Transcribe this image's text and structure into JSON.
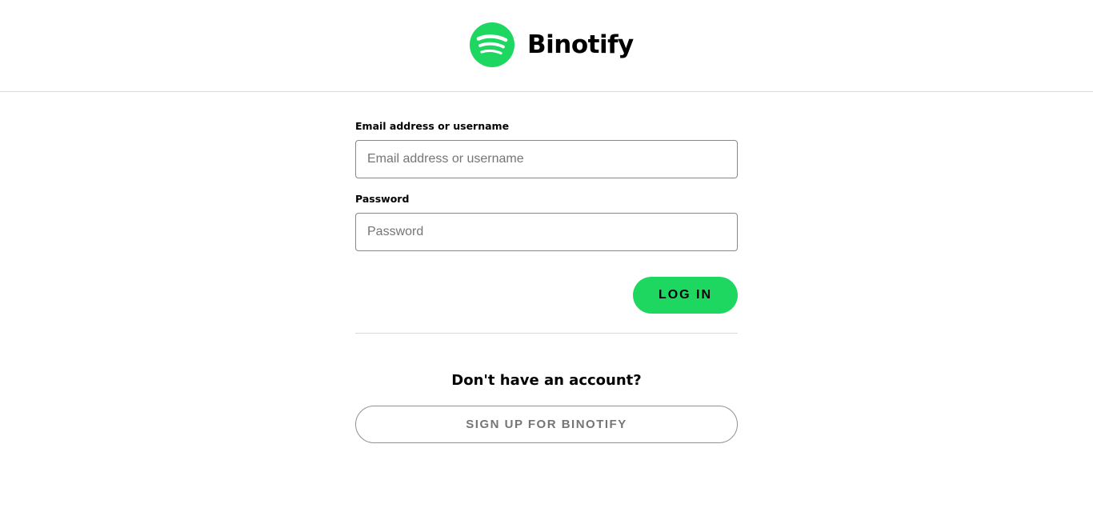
{
  "header": {
    "app_name": "Binotify",
    "logo_icon": "spotify-logo-icon"
  },
  "login_form": {
    "email": {
      "label": "Email address or username",
      "placeholder": "Email address or username",
      "value": ""
    },
    "password": {
      "label": "Password",
      "placeholder": "Password",
      "value": ""
    },
    "login_label": "LOG IN"
  },
  "signup": {
    "prompt": "Don't have an account?",
    "button_label": "SIGN UP FOR BINOTIFY"
  },
  "colors": {
    "brand_green": "#1ed760",
    "input_border": "#878787",
    "divider": "#d9d9d9",
    "muted_text": "#757575"
  }
}
